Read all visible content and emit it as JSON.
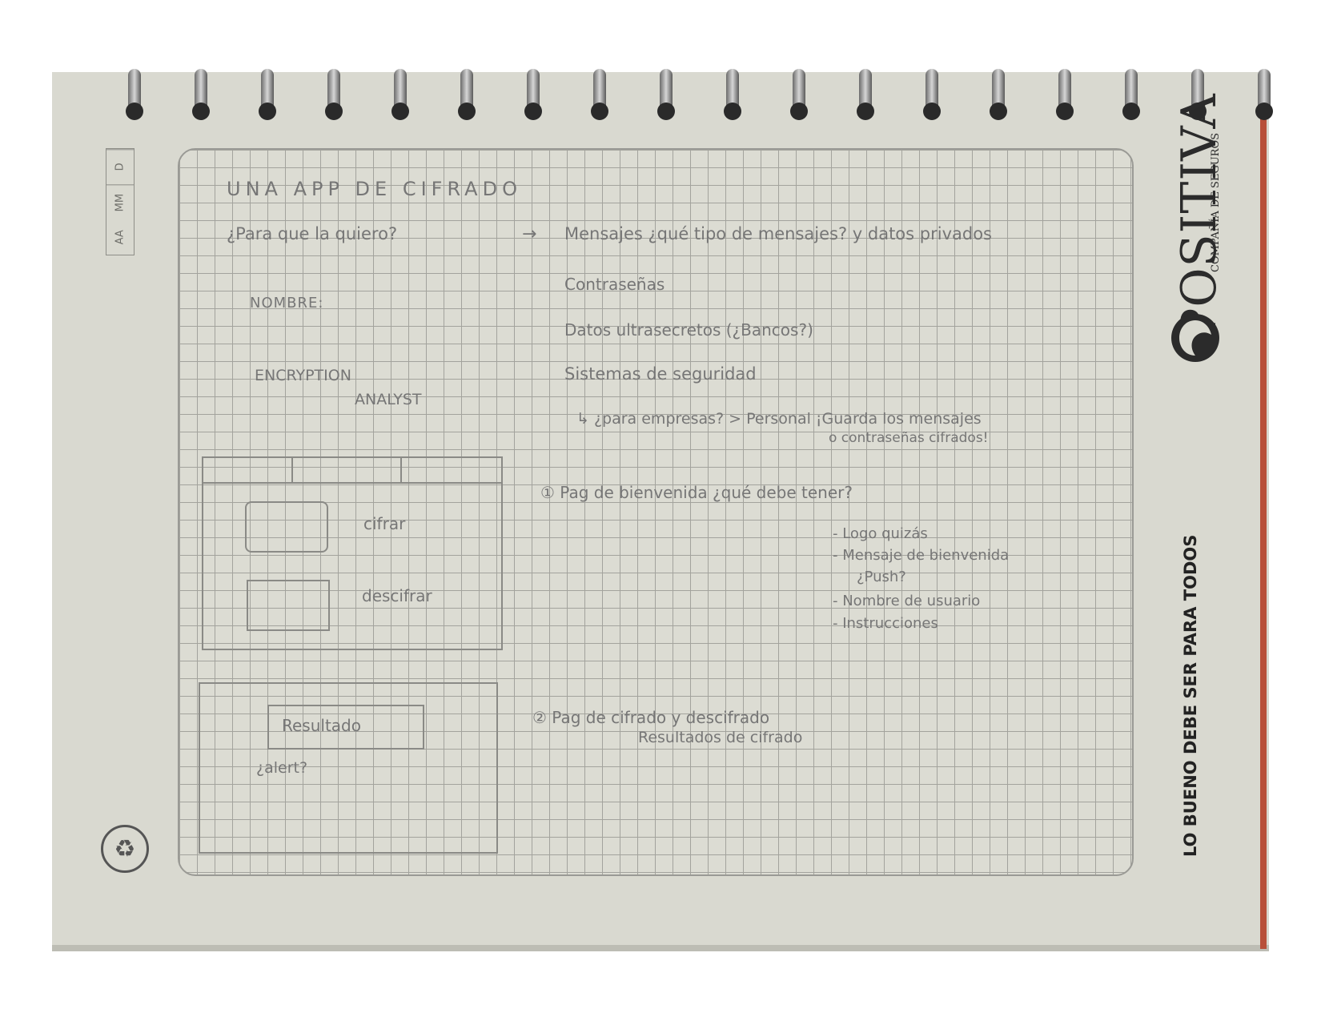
{
  "date_box": [
    "D",
    "MM",
    "AA"
  ],
  "notes": {
    "title": "UNA APP DE CIFRADO",
    "question": "¿Para que la quiero?",
    "arrow": "→",
    "answer": "Mensajes ¿qué tipo de mensajes? y datos privados",
    "item2": "Contraseñas",
    "item3": "Datos ultrasecretos (¿Bancos?)",
    "item4": "Sistemas de seguridad",
    "item5": "↳ ¿para empresas? > Personal ¡Guarda los mensajes",
    "item5b": "o contraseñas cifrados!",
    "nombre_label": "NOMBRE:",
    "nombre_value_1": "ENCRYPTION",
    "nombre_value_2": "ANALYST",
    "page1": "① Pag de bienvenida ¿qué debe tener?",
    "page1_items": [
      "- Logo quizás",
      "- Mensaje de bienvenida",
      "¿Push?",
      "- Nombre de usuario",
      "- Instrucciones"
    ],
    "page2": "② Pag de cifrado y descifrado",
    "page2_sub": "Resultados de cifrado"
  },
  "sketch1": {
    "btn1": "cifrar",
    "btn2": "descifrar"
  },
  "sketch2": {
    "result": "Resultado",
    "alert": "¿alert?"
  },
  "brand": {
    "name": "POSITIVA",
    "subtitle": "COMPAÑÍA DE SEGUROS",
    "slogan": "LO BUENO DEBE SER PARA TODOS"
  },
  "icons": {
    "recycle": "recycle-icon",
    "logo": "positiva-logo-icon"
  },
  "colors": {
    "paper": "#d9d9d0",
    "pencil": "#767676",
    "grid": "#a3a39d",
    "brand": "#2b2b2b"
  }
}
